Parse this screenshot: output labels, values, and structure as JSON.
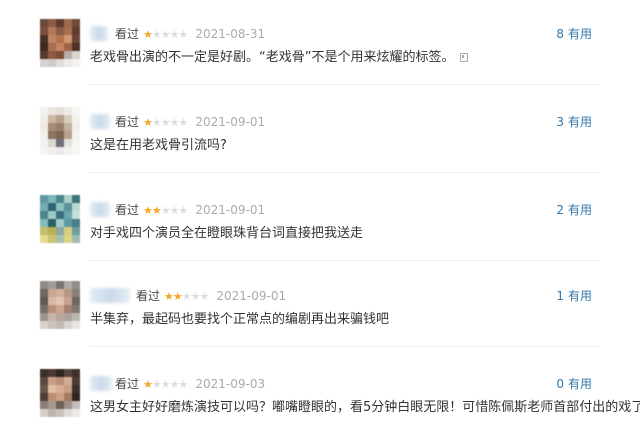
{
  "labels": {
    "watched": "看过",
    "useful": "有用"
  },
  "colors": {
    "link": "#3377aa",
    "star_on": "#f5a623",
    "star_off": "#dddddd",
    "date": "#aaaaaa"
  },
  "reviews": [
    {
      "rating_stars": 1,
      "date": "2021-08-31",
      "useful_count": "8",
      "comment": "老戏骨出演的不一定是好剧。“老戏骨”不是个用来炫耀的标签。"
    },
    {
      "rating_stars": 1,
      "date": "2021-09-01",
      "useful_count": "3",
      "comment": "这是在用老戏骨引流吗?"
    },
    {
      "rating_stars": 2,
      "date": "2021-09-01",
      "useful_count": "2",
      "comment": "对手戏四个演员全在瞪眼珠背台词直接把我送走"
    },
    {
      "rating_stars": 2,
      "date": "2021-09-01",
      "useful_count": "1",
      "comment": "半集弃，最起码也要找个正常点的编剧再出来骗钱吧"
    },
    {
      "rating_stars": 1,
      "date": "2021-09-03",
      "useful_count": "0",
      "comment": "这男女主好好磨炼演技可以吗？嘟嘴瞪眼的，看5分钟白眼无限！可惜陈佩斯老师首部付出的戏了"
    }
  ]
}
